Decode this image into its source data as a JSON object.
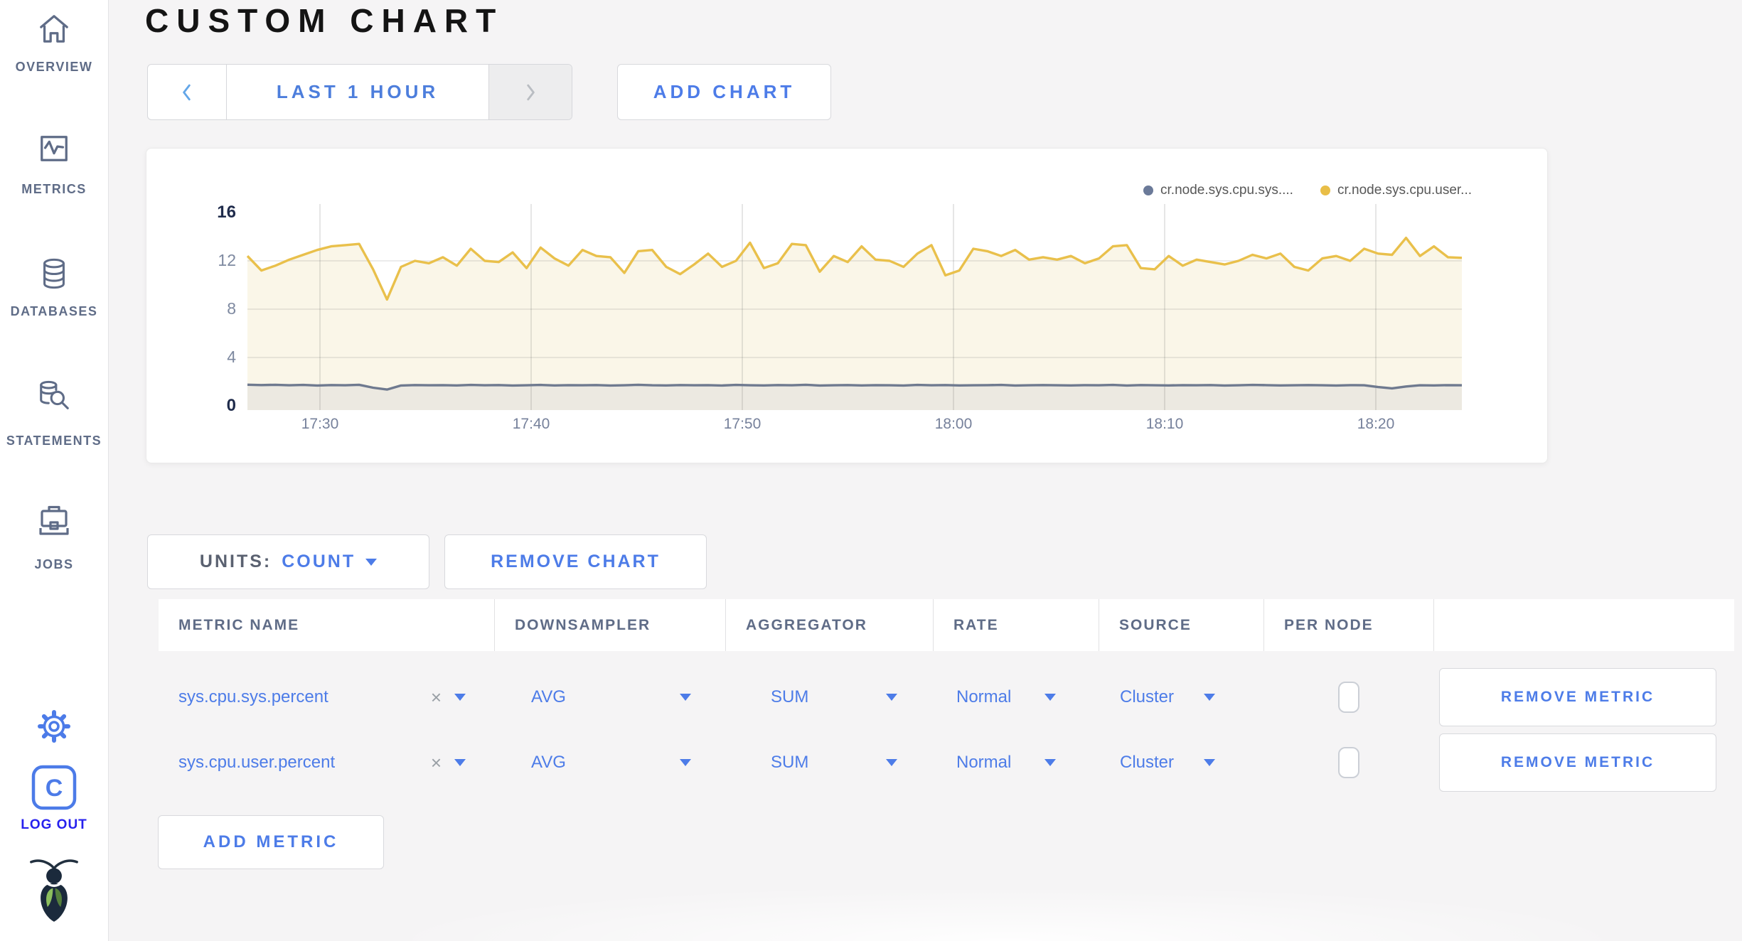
{
  "header": {
    "title": "CUSTOM CHART"
  },
  "sidebar": {
    "items": [
      {
        "label": "OVERVIEW",
        "icon": "home-icon"
      },
      {
        "label": "METRICS",
        "icon": "metrics-icon"
      },
      {
        "label": "DATABASES",
        "icon": "database-icon"
      },
      {
        "label": "STATEMENTS",
        "icon": "statements-icon"
      },
      {
        "label": "JOBS",
        "icon": "jobs-icon"
      }
    ],
    "settings_icon": "gear-icon",
    "logout_label": "LOG OUT",
    "logo_icon": "cockroachdb-bug-logo"
  },
  "toolbar": {
    "time_range_label": "LAST 1 HOUR",
    "add_chart_label": "ADD CHART"
  },
  "controls": {
    "units_label": "UNITS:",
    "units_value": "COUNT",
    "remove_chart_label": "REMOVE CHART",
    "add_metric_label": "ADD METRIC"
  },
  "chart_data": {
    "type": "area",
    "title": "",
    "x_ticks": [
      "17:30",
      "17:40",
      "17:50",
      "18:00",
      "18:10",
      "18:20"
    ],
    "y_ticks": [
      0,
      4,
      8,
      12,
      16
    ],
    "ylim": [
      0,
      16
    ],
    "grid": true,
    "legend_position": "top-right",
    "series": [
      {
        "name": "cr.node.sys.cpu.sys....",
        "dot": "#6B7A99",
        "line": "#6F7A8F",
        "fill": "#ECE9E1",
        "values": [
          1.75,
          1.72,
          1.74,
          1.7,
          1.73,
          1.68,
          1.72,
          1.7,
          1.74,
          1.5,
          1.35,
          1.68,
          1.72,
          1.7,
          1.71,
          1.69,
          1.73,
          1.7,
          1.72,
          1.68,
          1.7,
          1.73,
          1.69,
          1.71,
          1.7,
          1.72,
          1.68,
          1.7,
          1.74,
          1.7,
          1.69,
          1.72,
          1.7,
          1.71,
          1.68,
          1.73,
          1.7,
          1.69,
          1.72,
          1.7,
          1.74,
          1.68,
          1.7,
          1.72,
          1.69,
          1.71,
          1.7,
          1.68,
          1.73,
          1.7,
          1.72,
          1.69,
          1.7,
          1.71,
          1.73,
          1.68,
          1.7,
          1.72,
          1.7,
          1.69,
          1.71,
          1.7,
          1.73,
          1.68,
          1.72,
          1.7,
          1.69,
          1.71,
          1.7,
          1.72,
          1.68,
          1.7,
          1.73,
          1.71,
          1.69,
          1.7,
          1.72,
          1.7,
          1.68,
          1.71,
          1.7,
          1.55,
          1.45,
          1.6,
          1.7,
          1.69,
          1.71,
          1.7
        ]
      },
      {
        "name": "cr.node.sys.cpu.user...",
        "dot": "#E9BE47",
        "line": "#E9C04B",
        "fill": "#FAF6E8",
        "values": [
          12.4,
          11.2,
          11.6,
          12.1,
          12.5,
          12.9,
          13.2,
          13.3,
          13.4,
          11.3,
          8.8,
          11.5,
          12.0,
          11.8,
          12.3,
          11.6,
          13.0,
          12.0,
          11.9,
          12.7,
          11.4,
          13.1,
          12.2,
          11.6,
          12.9,
          12.4,
          12.3,
          11.0,
          12.8,
          12.9,
          11.5,
          10.9,
          11.7,
          12.6,
          11.5,
          12.0,
          13.5,
          11.4,
          11.8,
          13.4,
          13.3,
          11.1,
          12.4,
          11.9,
          13.2,
          12.1,
          12.0,
          11.5,
          12.6,
          13.3,
          10.8,
          11.2,
          13.0,
          12.8,
          12.4,
          12.9,
          12.1,
          12.3,
          12.1,
          12.4,
          11.8,
          12.2,
          13.2,
          13.3,
          11.4,
          11.3,
          12.4,
          11.6,
          12.1,
          11.9,
          11.7,
          12.0,
          12.5,
          12.2,
          12.6,
          11.5,
          11.2,
          12.2,
          12.4,
          12.0,
          13.0,
          12.6,
          12.5,
          13.9,
          12.4,
          13.2,
          12.3,
          12.25
        ]
      }
    ]
  },
  "table": {
    "headers": [
      "METRIC NAME",
      "DOWNSAMPLER",
      "AGGREGATOR",
      "RATE",
      "SOURCE",
      "PER NODE",
      ""
    ],
    "rows": [
      {
        "metric": "sys.cpu.sys.percent",
        "clear": "×",
        "downsampler": "AVG",
        "aggregator": "SUM",
        "rate": "Normal",
        "source": "Cluster",
        "per_node_checked": false,
        "remove_label": "REMOVE METRIC"
      },
      {
        "metric": "sys.cpu.user.percent",
        "clear": "×",
        "downsampler": "AVG",
        "aggregator": "SUM",
        "rate": "Normal",
        "source": "Cluster",
        "per_node_checked": false,
        "remove_label": "REMOVE METRIC"
      }
    ]
  },
  "colors": {
    "accent_blue": "#4D7CE8",
    "slate": "#5F6C87",
    "logout_blue": "#2721EE",
    "series_yellow": "#E9C04B",
    "series_gray": "#6F7A8F",
    "page_bg": "#F5F4F5"
  }
}
